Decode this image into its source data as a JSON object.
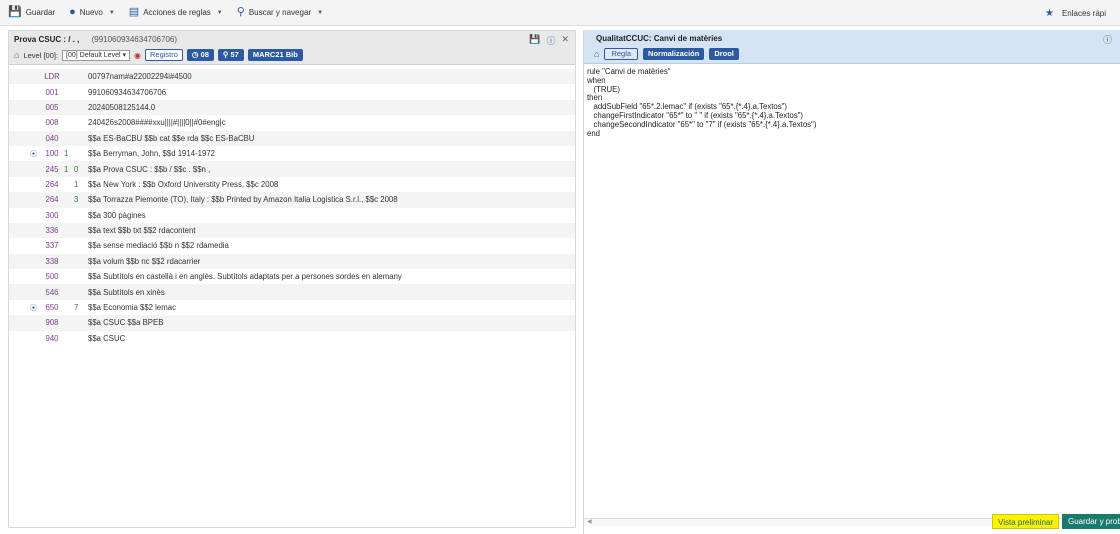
{
  "toolbar": {
    "save": "Guardar",
    "new": "Nuevo",
    "rule_actions": "Acciones de reglas",
    "search_nav": "Buscar y navegar",
    "quick_links": "Enlaces rápi"
  },
  "left": {
    "title_bold": "Prova CSUC : / . ,",
    "record_id": "(991060934634706706)",
    "level_label": "Level [00]:",
    "level_select": "[00] Default Level",
    "registro": "Registro",
    "count_a": "08",
    "count_b": "57",
    "format": "MARC21 Bib",
    "records": [
      {
        "tag": "LDR",
        "i1": "",
        "i2": "",
        "val": "00797nam#a22002294i#4500",
        "eye": false
      },
      {
        "tag": "001",
        "i1": "",
        "i2": "",
        "val": "991060934634706706",
        "eye": false
      },
      {
        "tag": "005",
        "i1": "",
        "i2": "",
        "val": "20240508125144.0",
        "eye": false
      },
      {
        "tag": "008",
        "i1": "",
        "i2": "",
        "val": "240426s2008####xxu||||#||||0||#0#eng|c",
        "eye": false
      },
      {
        "tag": "040",
        "i1": "",
        "i2": "",
        "val": "$$a ES-BaCBU $$b cat $$e rda $$c ES-BaCBU",
        "eye": false
      },
      {
        "tag": "100",
        "i1": "1",
        "i2": "",
        "val": "$$a Berryman, John, $$d 1914-1972",
        "eye": true
      },
      {
        "tag": "245",
        "i1": "1",
        "i2": "0",
        "val": "$$a Prova CSUC : $$b / $$c . $$n ,",
        "eye": false
      },
      {
        "tag": "264",
        "i1": "",
        "i2": "1",
        "val": "$$a New York : $$b Oxford Universtity Press, $$c 2008",
        "eye": false
      },
      {
        "tag": "264",
        "i1": "",
        "i2": "3",
        "val": "$$a Torrazza Piemonte (TO), Italy : $$b Printed by Amazon Italia Logistica S.r.l., $$c 2008",
        "eye": false
      },
      {
        "tag": "300",
        "i1": "",
        "i2": "",
        "val": "$$a 300 pàgines",
        "eye": false
      },
      {
        "tag": "336",
        "i1": "",
        "i2": "",
        "val": "$$a text $$b txt $$2 rdacontent",
        "eye": false
      },
      {
        "tag": "337",
        "i1": "",
        "i2": "",
        "val": "$$a sense mediació $$b n $$2 rdamedia",
        "eye": false
      },
      {
        "tag": "338",
        "i1": "",
        "i2": "",
        "val": "$$a volum $$b nc $$2 rdacarrier",
        "eye": false
      },
      {
        "tag": "500",
        "i1": "",
        "i2": "",
        "val": "$$a Subtítols en castellà i en anglès. Subtítols adaptats per a persones sordes en alemany",
        "eye": false
      },
      {
        "tag": "546",
        "i1": "",
        "i2": "",
        "val": "$$a Subtítols en xinès",
        "eye": false
      },
      {
        "tag": "650",
        "i1": "",
        "i2": "7",
        "val": "$$a Economia $$2 lemac",
        "eye": true
      },
      {
        "tag": "908",
        "i1": "",
        "i2": "",
        "val": "$$a CSUC $$a BPEB",
        "eye": false
      },
      {
        "tag": "940",
        "i1": "",
        "i2": "",
        "val": "$$a CSUC",
        "eye": false
      }
    ]
  },
  "right": {
    "title": "QualitatCCUC: Canvi de matèries",
    "tab_regla": "Regla",
    "tab_norm": "Normalización",
    "tab_drool": "Drool",
    "code": [
      "rule \"Canvi de matèries\"",
      "when",
      "   (TRUE)",
      "then",
      "   addSubField \"65*.2.lemac\" if (exists \"65*.{*.4}.a.Textos\")",
      "   changeFirstIndicator \"65*\" to \" \" if (exists \"65*.{*.4}.a.Textos\")",
      "   changeSecondIndicator \"65*\" to \"7\" if (exists \"65*.{*.4}.a.Textos\")",
      "end"
    ],
    "preview_btn": "Vista preliminar",
    "save_test_btn": "Guardar y proba"
  }
}
